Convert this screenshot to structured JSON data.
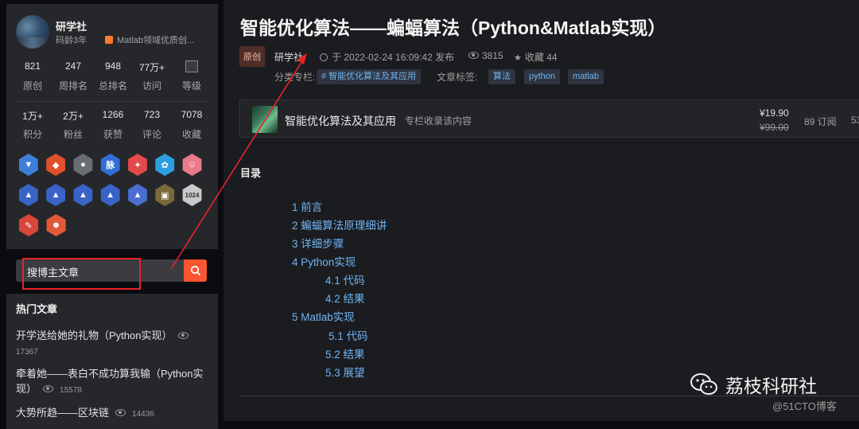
{
  "profile": {
    "name": "研学社",
    "age": "码龄3年",
    "tag": "Matlab领域优质创...",
    "stats_row1": [
      {
        "num": "821",
        "label": "原创"
      },
      {
        "num": "247",
        "label": "周排名"
      },
      {
        "num": "948",
        "label": "总排名"
      },
      {
        "num": "77万+",
        "label": "访问"
      },
      {
        "num": "",
        "label": "等级"
      }
    ],
    "stats_row2": [
      {
        "num": "1万+",
        "label": "积分"
      },
      {
        "num": "2万+",
        "label": "粉丝"
      },
      {
        "num": "1266",
        "label": "获赞"
      },
      {
        "num": "723",
        "label": "评论"
      },
      {
        "num": "7078",
        "label": "收藏"
      }
    ],
    "badges_row3_label": "1024",
    "badge_text_mai": "脉"
  },
  "search": {
    "value": "搜博主文章"
  },
  "hot": {
    "title": "热门文章",
    "items": [
      {
        "title": "开学送给她的礼物（Python实现）",
        "views": "17367"
      },
      {
        "title_line1": "牵着她——表白不成功算我输（Python实",
        "title_line2": "现）",
        "views": "15578"
      },
      {
        "title": "大势所趋——区块链",
        "views": "14436"
      }
    ]
  },
  "article": {
    "title": "智能优化算法——蝙蝠算法（Python&Matlab实现）",
    "original": "原创",
    "author": "研学社",
    "time": "于 2022-02-24 16:09:42 发布",
    "views": "3815",
    "favorites": "收藏 44",
    "category_label": "分类专栏:",
    "category_tag": "# 智能优化算法及其应用",
    "tags_label": "文章标签:",
    "tags": [
      "算法",
      "python",
      "matlab"
    ]
  },
  "column": {
    "title": "智能优化算法及其应用",
    "subtitle": "专栏收录该内容",
    "price": "¥19.90",
    "old_price": "¥99.00",
    "subs": "89 订阅",
    "more": "53"
  },
  "toc": {
    "title": "目录",
    "items": [
      "1 前言",
      "2 蝙蝠算法原理细讲",
      "3 详细步骤",
      "4 Python实现",
      "4.1 代码",
      "4.2 结果",
      "5 Matlab实现",
      "5.1 代码",
      "5.2 结果",
      "5.3 展望"
    ]
  },
  "watermark": {
    "text": "荔枝科研社",
    "site": "@51CTO博客"
  }
}
